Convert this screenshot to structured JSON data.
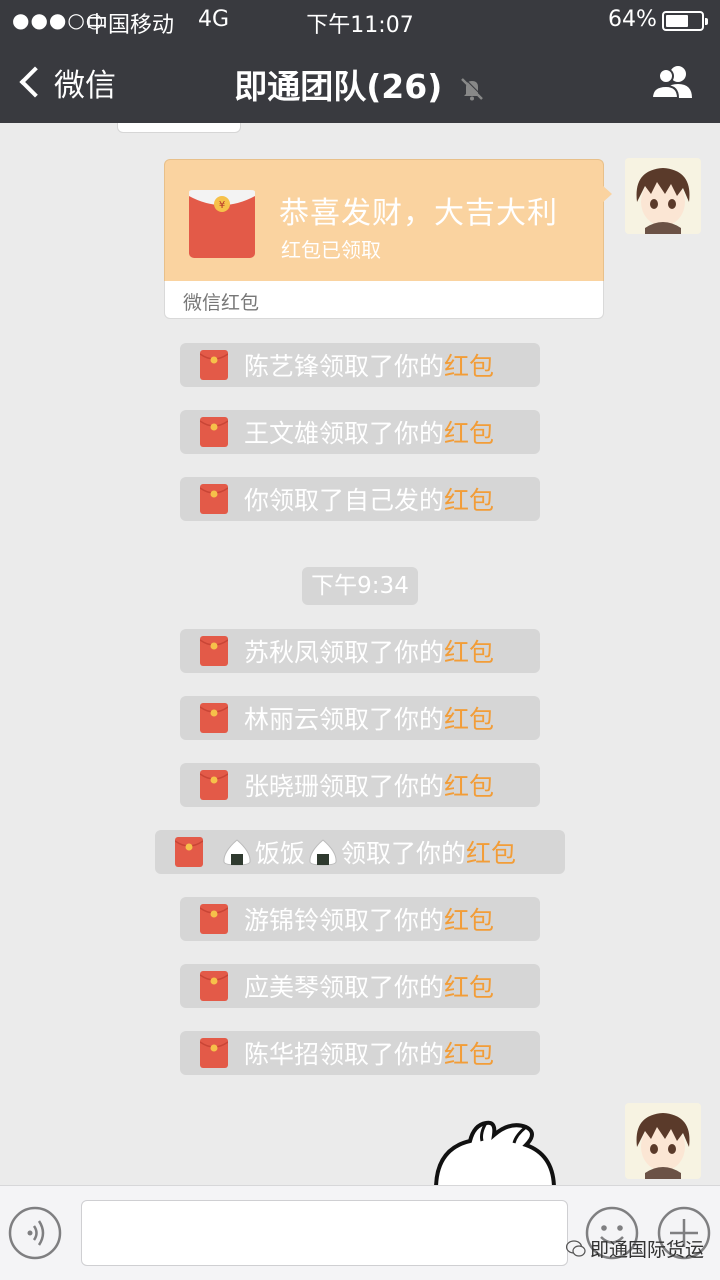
{
  "status_bar": {
    "signal": "●●●○○",
    "carrier": "中国移动",
    "network": "4G",
    "time": "下午11:07",
    "battery_text": "64%",
    "battery_level": 0.64
  },
  "header": {
    "back_label": "微信",
    "title": "即通团队(26)",
    "muted": true
  },
  "red_packet_message": {
    "greeting": "恭喜发财，大吉大利",
    "state": "红包已领取",
    "source": "微信红包",
    "card_color": "#fad3a0"
  },
  "notices_before": [
    {
      "name": "陈艺锋",
      "suffix": "领取了你的",
      "link": "红包"
    },
    {
      "name": "王文雄",
      "suffix": "领取了你的",
      "link": "红包"
    },
    {
      "name": "",
      "prefix": "你领取了自己发的",
      "link": "红包"
    }
  ],
  "timestamp": "下午9:34",
  "notices_after": [
    {
      "name": "苏秋凤",
      "suffix": "领取了你的",
      "link": "红包"
    },
    {
      "name": "林丽云",
      "suffix": "领取了你的",
      "link": "红包"
    },
    {
      "name": "张晓珊",
      "suffix": "领取了你的",
      "link": "红包"
    },
    {
      "name": "饭饭",
      "suffix": "领取了你的",
      "link": "红包",
      "emoji": "rice-ball"
    },
    {
      "name": "游锦铃",
      "suffix": "领取了你的",
      "link": "红包"
    },
    {
      "name": "应美琴",
      "suffix": "领取了你的",
      "link": "红包"
    },
    {
      "name": "陈华招",
      "suffix": "领取了你的",
      "link": "红包"
    }
  ],
  "input_bar": {
    "placeholder": ""
  },
  "watermark": "即通国际货运",
  "colors": {
    "header_bg": "#393a3f",
    "chat_bg": "#ebebeb",
    "notice_bg": "#d6d6d6",
    "link": "#f29d38",
    "packet_red": "#e35a48"
  }
}
